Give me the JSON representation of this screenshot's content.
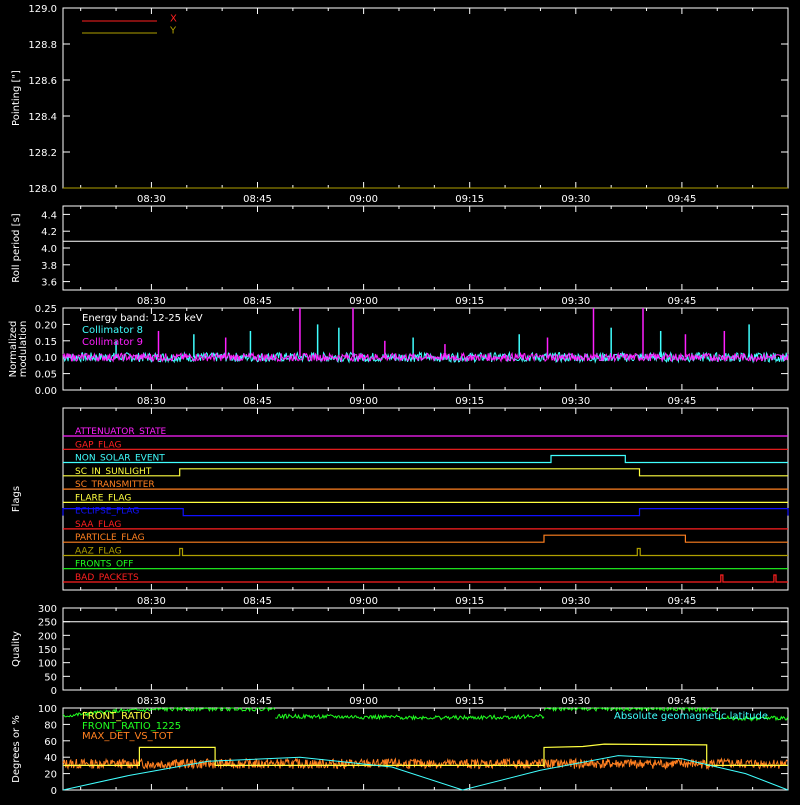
{
  "colors": {
    "background": "#000000",
    "axis": "#ffffff",
    "red": "#ff2020",
    "yellow": "#ffff40",
    "olive": "#b0a000",
    "cyan": "#40ffff",
    "magenta": "#ff20ff",
    "blue": "#1010ff",
    "orange": "#ff8020",
    "green": "#20ff20"
  },
  "time_ticks": [
    "08:30",
    "08:45",
    "09:00",
    "09:15",
    "09:30",
    "09:45"
  ],
  "time_tick_minutes": [
    510,
    525,
    540,
    555,
    570,
    585
  ],
  "time_range_minutes": [
    497.5,
    600
  ],
  "chart_data": [
    {
      "type": "line",
      "panel": "pointing",
      "ylabel": "Pointing [\"]",
      "ylim": [
        128.0,
        129.0
      ],
      "yticks": [
        "129.0",
        "128.8",
        "128.6",
        "128.4",
        "128.2",
        "128.0"
      ],
      "ytick_values": [
        129.0,
        128.8,
        128.6,
        128.4,
        128.2,
        128.0
      ],
      "legend_placement": "top-left",
      "series": [
        {
          "name": "X",
          "color": "red",
          "x": [
            497.5,
            600
          ],
          "y": [
            128.0,
            128.0
          ]
        },
        {
          "name": "Y",
          "color": "olive",
          "x": [
            497.5,
            600
          ],
          "y": [
            128.0,
            128.0
          ]
        }
      ]
    },
    {
      "type": "line",
      "panel": "roll",
      "ylabel": "Roll period [s]",
      "ylim": [
        3.5,
        4.5
      ],
      "yticks": [
        "4.4",
        "4.2",
        "4.0",
        "3.8",
        "3.6"
      ],
      "ytick_values": [
        4.4,
        4.2,
        4.0,
        3.8,
        3.6
      ],
      "series": [
        {
          "name": "",
          "color": "axis",
          "x": [
            497.5,
            600
          ],
          "y": [
            4.08,
            4.08
          ]
        }
      ]
    },
    {
      "type": "line",
      "panel": "modulation",
      "ylabel_lines": [
        "Normalized",
        "modulation"
      ],
      "ylim": [
        0.0,
        0.25
      ],
      "yticks": [
        "0.25",
        "0.20",
        "0.15",
        "0.10",
        "0.05",
        "0.00"
      ],
      "ytick_values": [
        0.25,
        0.2,
        0.15,
        0.1,
        0.05,
        0.0
      ],
      "annotation": "Energy band: 12-25 keV",
      "baseline": 0.1,
      "noise": 0.012,
      "series": [
        {
          "name": "Collimator 8",
          "color": "cyan"
        },
        {
          "name": "Collimator 9",
          "color": "magenta"
        }
      ],
      "spikes_collimator_9": [
        {
          "x": 511.0,
          "y": 0.18
        },
        {
          "x": 520.5,
          "y": 0.16
        },
        {
          "x": 531.0,
          "y": 0.25
        },
        {
          "x": 538.5,
          "y": 0.25
        },
        {
          "x": 543.0,
          "y": 0.15
        },
        {
          "x": 551.5,
          "y": 0.14
        },
        {
          "x": 566.0,
          "y": 0.16
        },
        {
          "x": 572.5,
          "y": 0.25
        },
        {
          "x": 579.5,
          "y": 0.25
        },
        {
          "x": 585.5,
          "y": 0.17
        },
        {
          "x": 591.0,
          "y": 0.18
        }
      ],
      "spikes_collimator_8": [
        {
          "x": 505.0,
          "y": 0.15
        },
        {
          "x": 516.0,
          "y": 0.17
        },
        {
          "x": 524.0,
          "y": 0.18
        },
        {
          "x": 533.5,
          "y": 0.2
        },
        {
          "x": 536.5,
          "y": 0.19
        },
        {
          "x": 547.0,
          "y": 0.16
        },
        {
          "x": 562.0,
          "y": 0.17
        },
        {
          "x": 575.0,
          "y": 0.19
        },
        {
          "x": 582.0,
          "y": 0.18
        },
        {
          "x": 594.5,
          "y": 0.2
        }
      ]
    },
    {
      "type": "line",
      "panel": "flags",
      "ylabel": "Flags",
      "flags": [
        {
          "name": "ATTENUATOR_STATE",
          "color": "magenta",
          "on": []
        },
        {
          "name": "GAP_FLAG",
          "color": "red",
          "on": []
        },
        {
          "name": "NON_SOLAR_EVENT",
          "color": "cyan",
          "on": [
            [
              566.5,
              577.0
            ]
          ]
        },
        {
          "name": "SC_IN_SUNLIGHT",
          "color": "yellow",
          "on": [
            [
              514.0,
              579.0
            ]
          ]
        },
        {
          "name": "SC_TRANSMITTER",
          "color": "orange",
          "on": []
        },
        {
          "name": "FLARE_FLAG",
          "color": "yellow",
          "on": []
        },
        {
          "name": "ECLIPSE_FLAG",
          "color": "blue",
          "on": [
            [
              497.5,
              514.5
            ],
            [
              579.0,
              600.0
            ]
          ]
        },
        {
          "name": "SAA_FLAG",
          "color": "red",
          "on": []
        },
        {
          "name": "PARTICLE_FLAG",
          "color": "orange",
          "on": [
            [
              565.5,
              585.5
            ]
          ]
        },
        {
          "name": "AAZ_FLAG",
          "color": "olive",
          "on": [
            [
              514.0,
              514.4
            ],
            [
              578.7,
              579.1
            ]
          ]
        },
        {
          "name": "FRONTS_OFF",
          "color": "green",
          "on": []
        },
        {
          "name": "BAD_PACKETS",
          "color": "red",
          "on": [
            [
              590.5,
              590.8
            ],
            [
              598.0,
              598.3
            ]
          ]
        }
      ]
    },
    {
      "type": "line",
      "panel": "quality",
      "ylabel": "Quality",
      "ylim": [
        0,
        300
      ],
      "yticks": [
        "300",
        "250",
        "200",
        "150",
        "100",
        "50",
        "0"
      ],
      "ytick_values": [
        300,
        250,
        200,
        150,
        100,
        50,
        0
      ],
      "series": [
        {
          "name": "",
          "color": "axis",
          "x": [
            497.5,
            600
          ],
          "y": [
            250,
            250
          ]
        }
      ]
    },
    {
      "type": "line",
      "panel": "ratios",
      "ylabel": "Degrees or %",
      "ylim": [
        0,
        100
      ],
      "yticks": [
        "100",
        "80",
        "60",
        "40",
        "20",
        "0"
      ],
      "ytick_values": [
        100,
        80,
        60,
        40,
        20,
        0
      ],
      "series": [
        {
          "name": "FRONT_RATIO",
          "color": "yellow",
          "x": [
            497.5,
            508.3,
            508.3,
            519.0,
            519.0,
            565.5,
            565.5,
            571.0,
            574.0,
            588.5,
            588.5,
            600.0
          ],
          "y": [
            30,
            30,
            52,
            52,
            30,
            30,
            52,
            53,
            56,
            55,
            30,
            30
          ]
        },
        {
          "name": "FRONT_RATIO_1225",
          "color": "green",
          "segments": [
            {
              "x": [
                497.5,
                501.0,
                505.0,
                514.0,
                524.0,
                527.5
              ],
              "y": [
                90,
                93,
                96,
                99,
                99,
                99
              ]
            },
            {
              "x": [
                527.5,
                540.0,
                555.0,
                565.5
              ],
              "y": [
                90,
                89,
                88,
                90
              ]
            },
            {
              "x": [
                565.5,
                575.0,
                585.0,
                590.0
              ],
              "y": [
                99,
                99,
                99,
                97
              ]
            },
            {
              "x": [
                590.0,
                595.0,
                600.0
              ],
              "y": [
                88,
                87,
                88
              ]
            }
          ]
        },
        {
          "name": "MAX_DET_VS_TOT",
          "color": "orange",
          "baseline": 32,
          "noise": 6
        },
        {
          "name": "Absolute geomagnetic latitude",
          "color": "cyan",
          "x": [
            497.5,
            507.0,
            518.0,
            531.0,
            544.0,
            554.0,
            565.0,
            576.0,
            585.0,
            594.0,
            600.0
          ],
          "y": [
            0,
            18,
            35,
            40,
            28,
            0,
            24,
            42,
            38,
            20,
            0
          ]
        }
      ]
    }
  ]
}
